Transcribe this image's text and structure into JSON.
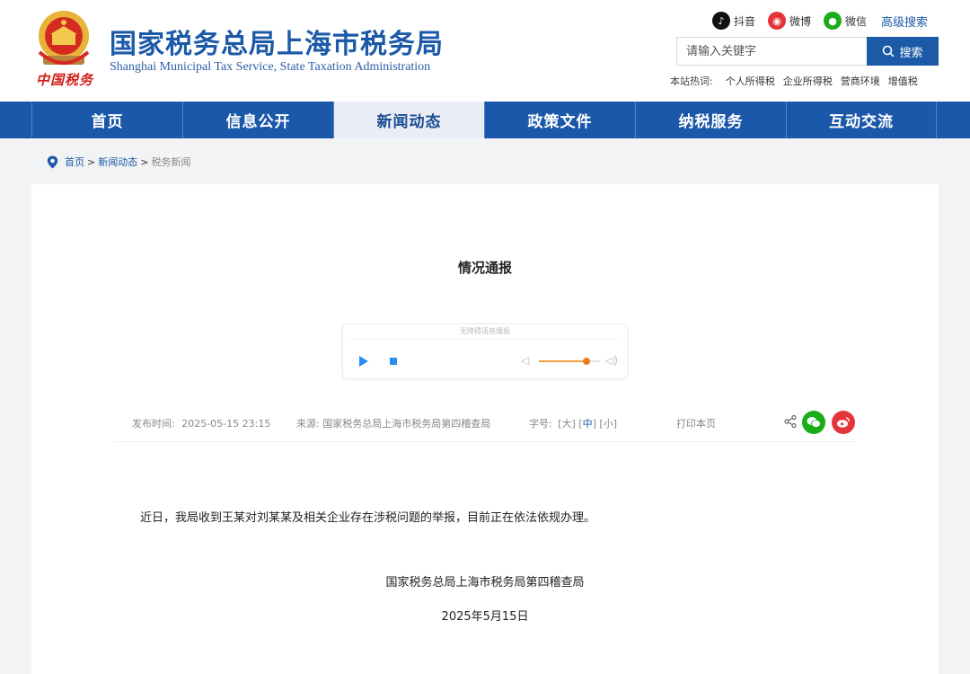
{
  "header": {
    "title_cn": "国家税务总局上海市税务局",
    "title_en": "Shanghai Municipal Tax Service, State Taxation Administration",
    "emblem_caption": "中国税务",
    "social": [
      {
        "label": "抖音",
        "icon": "douyin-icon",
        "color": "#111111"
      },
      {
        "label": "微博",
        "icon": "weibo-icon",
        "color": "#e6353a"
      },
      {
        "label": "微信",
        "icon": "wechat-icon",
        "color": "#1aad19"
      }
    ],
    "advanced_search": "高级搜索",
    "search": {
      "placeholder": "请输入关键字",
      "button": "搜索"
    },
    "hotwords_label": "本站热词:",
    "hotwords": [
      "个人所得税",
      "企业所得税",
      "营商环境",
      "增值税"
    ]
  },
  "nav": {
    "items": [
      "首页",
      "信息公开",
      "新闻动态",
      "政策文件",
      "纳税服务",
      "互动交流"
    ],
    "active_index": 2
  },
  "breadcrumb": {
    "items": [
      "首页",
      "新闻动态"
    ],
    "current": "税务新闻"
  },
  "article": {
    "title": "情况通报",
    "audio": {
      "caption": "无障碍语音播报",
      "volume": 0.78
    },
    "meta": {
      "date_label": "发布时间:",
      "date_value": "2025-05-15 23:15",
      "source_label": "来源:",
      "source_value": "国家税务总局上海市税务局第四稽查局",
      "font_label": "字号:",
      "font_sizes": [
        "大",
        "中",
        "小"
      ],
      "font_active": 1,
      "print": "打印本页"
    },
    "body": "近日，我局收到王某对刘某某及相关企业存在涉税问题的举报，目前正在依法依规办理。",
    "sign_org": "国家税务总局上海市税务局第四稽查局",
    "sign_date": "2025年5月15日"
  },
  "colors": {
    "brand_blue": "#1b58aa",
    "active_tab_bg": "#e9eef6",
    "volume": "#ec7a1e"
  }
}
